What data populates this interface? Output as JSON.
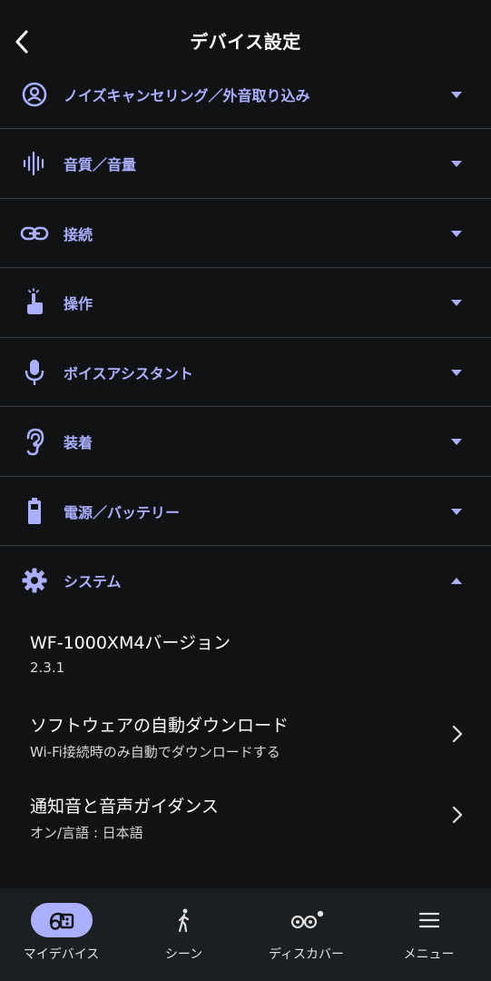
{
  "header": {
    "title": "デバイス設定"
  },
  "sections": [
    {
      "label": "ノイズキャンセリング／外音取り込み",
      "icon": "noise-cancel-icon",
      "expanded": false
    },
    {
      "label": "音質／音量",
      "icon": "sound-wave-icon",
      "expanded": false
    },
    {
      "label": "接続",
      "icon": "link-icon",
      "expanded": false
    },
    {
      "label": "操作",
      "icon": "touch-icon",
      "expanded": false
    },
    {
      "label": "ボイスアシスタント",
      "icon": "microphone-icon",
      "expanded": false
    },
    {
      "label": "装着",
      "icon": "ear-icon",
      "expanded": false
    },
    {
      "label": "電源／バッテリー",
      "icon": "battery-icon",
      "expanded": false
    },
    {
      "label": "システム",
      "icon": "gear-icon",
      "expanded": true
    }
  ],
  "system_items": [
    {
      "title": "WF-1000XM4バージョン",
      "subtitle": "2.3.1",
      "has_arrow": false
    },
    {
      "title": "ソフトウェアの自動ダウンロード",
      "subtitle": "Wi-Fi接続時のみ自動でダウンロードする",
      "has_arrow": true
    },
    {
      "title": "通知音と音声ガイダンス",
      "subtitle": "オン/言語 : 日本語",
      "has_arrow": true
    }
  ],
  "bottom_nav": [
    {
      "label": "マイデバイス",
      "icon": "headphones-icon",
      "active": true
    },
    {
      "label": "シーン",
      "icon": "walking-icon",
      "active": false
    },
    {
      "label": "ディスカバー",
      "icon": "binoculars-icon",
      "active": false,
      "badge": true
    },
    {
      "label": "メニュー",
      "icon": "menu-icon",
      "active": false
    }
  ],
  "colors": {
    "background": "#101213",
    "accent": "#aab0ff",
    "divider": "#3b3e41",
    "nav_background": "#1c1f21"
  }
}
